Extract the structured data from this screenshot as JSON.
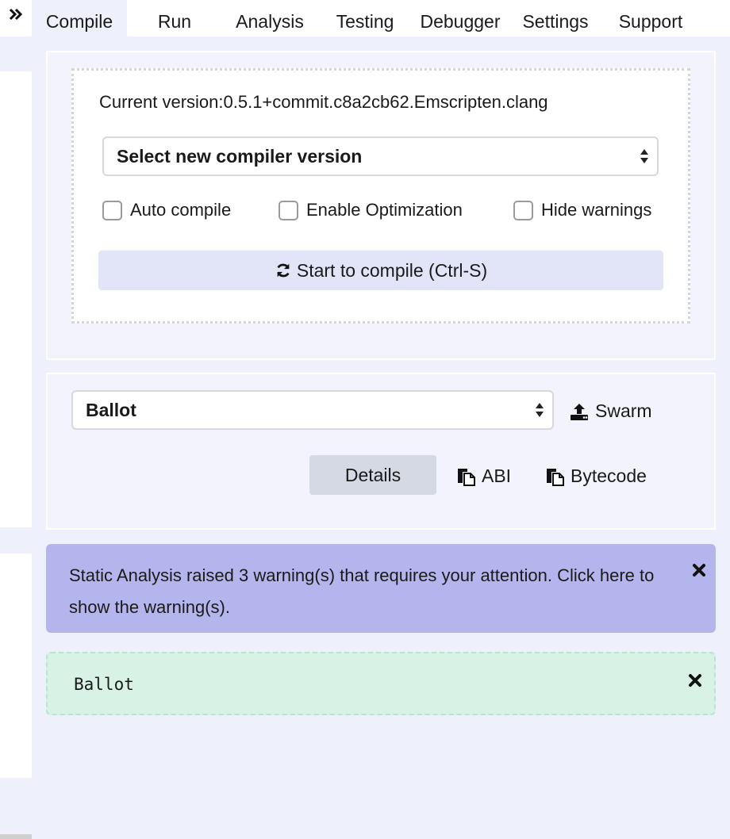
{
  "tabs": [
    {
      "label": "Compile",
      "active": true
    },
    {
      "label": "Run",
      "active": false
    },
    {
      "label": "Analysis",
      "active": false
    },
    {
      "label": "Testing",
      "active": false
    },
    {
      "label": "Debugger",
      "active": false
    },
    {
      "label": "Settings",
      "active": false
    },
    {
      "label": "Support",
      "active": false
    }
  ],
  "compiler": {
    "current_version": "Current version:0.5.1+commit.c8a2cb62.Emscripten.clang",
    "select_label": "Select new compiler version",
    "options": {
      "auto_compile": {
        "label": "Auto compile",
        "checked": false
      },
      "enable_optimization": {
        "label": "Enable Optimization",
        "checked": false
      },
      "hide_warnings": {
        "label": "Hide warnings",
        "checked": false
      }
    },
    "compile_button": "Start to compile (Ctrl-S)"
  },
  "contract": {
    "selected": "Ballot",
    "swarm_label": "Swarm",
    "details_label": "Details",
    "abi_label": "ABI",
    "bytecode_label": "Bytecode"
  },
  "warning": {
    "text": "Static Analysis raised 3 warning(s) that requires your attention. Click here to show the warning(s)."
  },
  "result": {
    "contract_name": "Ballot"
  },
  "icons": {
    "collapse": "double-chevron-right-icon",
    "refresh": "refresh-icon",
    "upload": "upload-icon",
    "copy": "copy-icon",
    "close": "close-icon",
    "select_arrows": "sort-arrows-icon"
  },
  "colors": {
    "background": "#eef0fb",
    "panel": "#f2f3fc",
    "compile_button": "#e1e5f7",
    "details_button": "#d5d9e4",
    "warning": "#b5b5ee",
    "success": "#d9f2e6"
  }
}
